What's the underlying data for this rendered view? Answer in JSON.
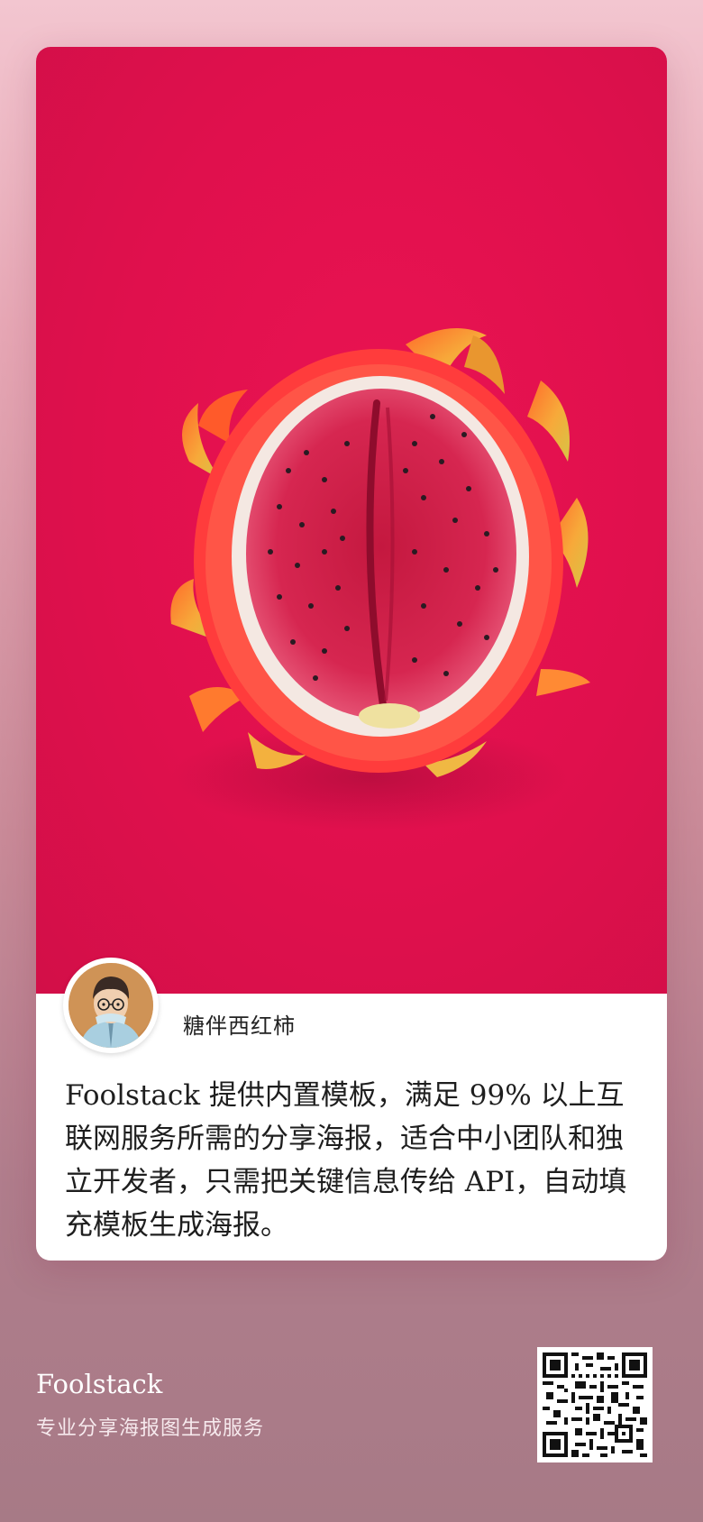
{
  "poster": {
    "author_name": "糖伴西红柿",
    "description": "Foolstack 提供内置模板，满足 99% 以上互联网服务所需的分享海报，适合中小团队和独立开发者，只需把关键信息传给 API，自动填充模板生成海报。",
    "hero_image": "dragon-fruit-photo",
    "avatar_image": "cartoon-portrait-avatar"
  },
  "brand": {
    "name": "Foolstack",
    "slogan": "专业分享海报图生成服务",
    "qr_code": "qr-code-icon"
  },
  "colors": {
    "photo_background": "#e0104d",
    "card_background": "#ffffff",
    "page_gradient_top": "#f3c6d0",
    "page_gradient_bottom": "#a77a86"
  }
}
